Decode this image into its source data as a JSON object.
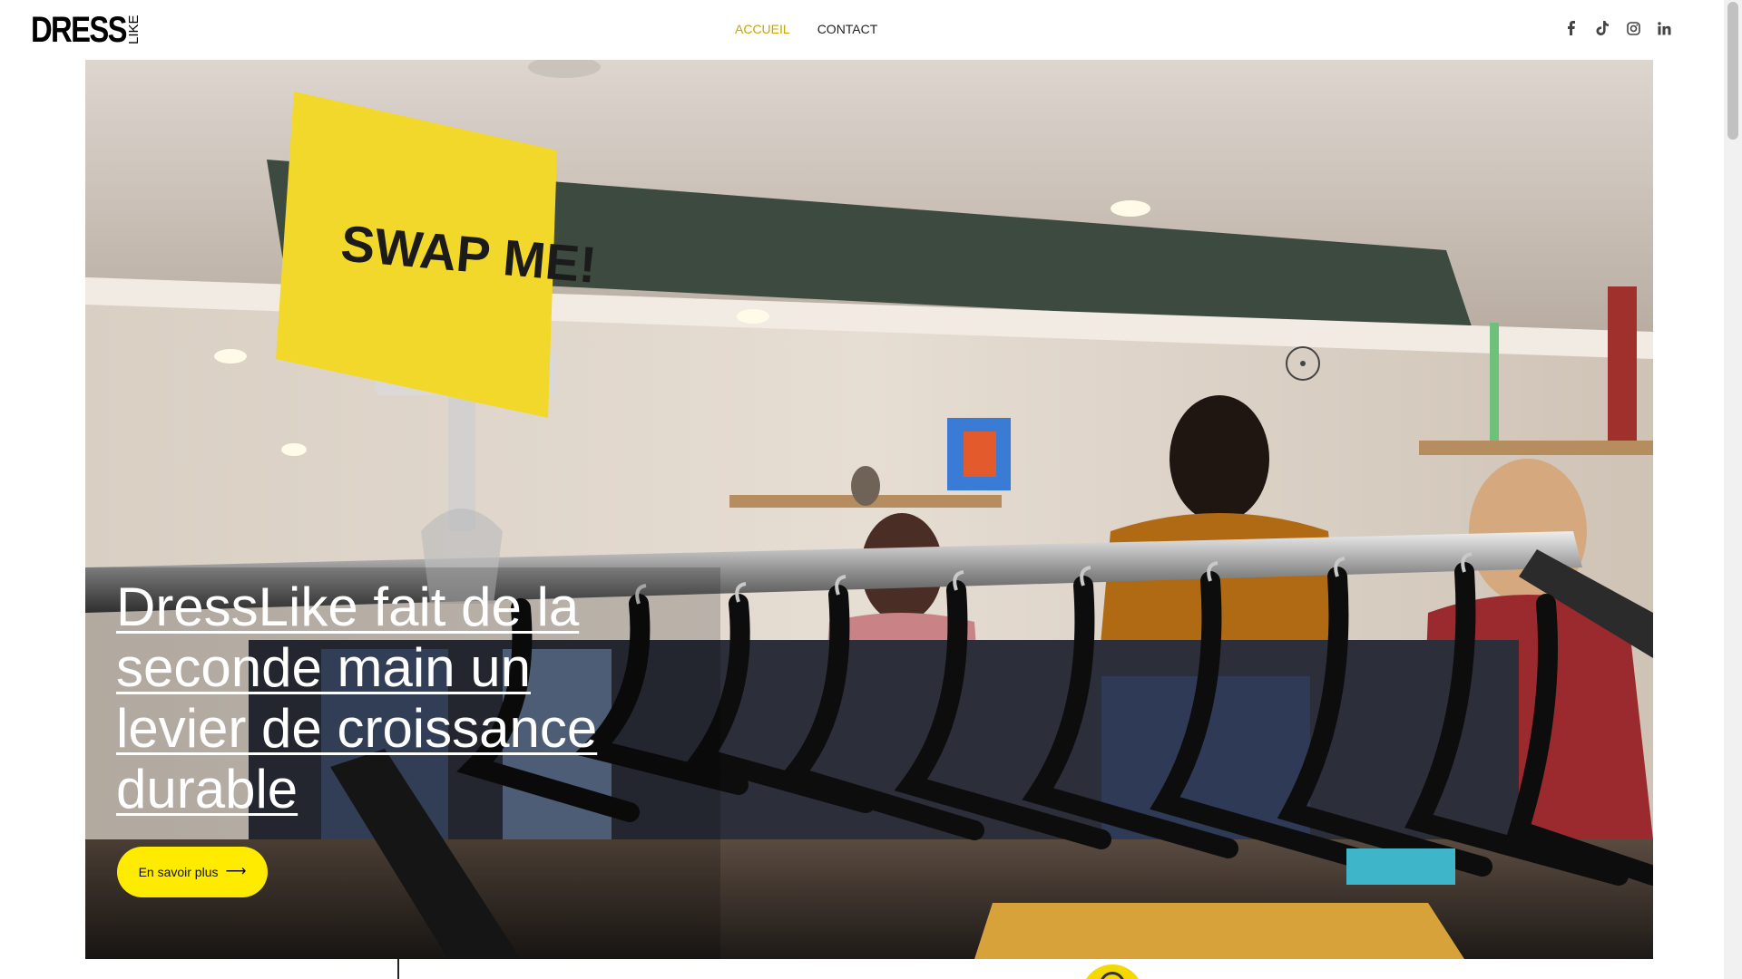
{
  "brand": {
    "logo_main": "DRESS",
    "logo_side": "LIKE"
  },
  "nav": {
    "items": [
      {
        "label": "ACCUEIL",
        "active": true
      },
      {
        "label": "CONTACT",
        "active": false
      }
    ]
  },
  "socials": [
    "facebook-icon",
    "tiktok-icon",
    "instagram-icon",
    "linkedin-icon"
  ],
  "hero": {
    "sign_text": "SWAP ME!",
    "title": "DressLike fait de la seconde main un levier de croissance durable",
    "cta_label": "En savoir plus",
    "cta_icon": "arrow-right-icon"
  },
  "colors": {
    "accent": "#ffeb00",
    "active_nav": "#c9a400",
    "text": "#222222"
  }
}
